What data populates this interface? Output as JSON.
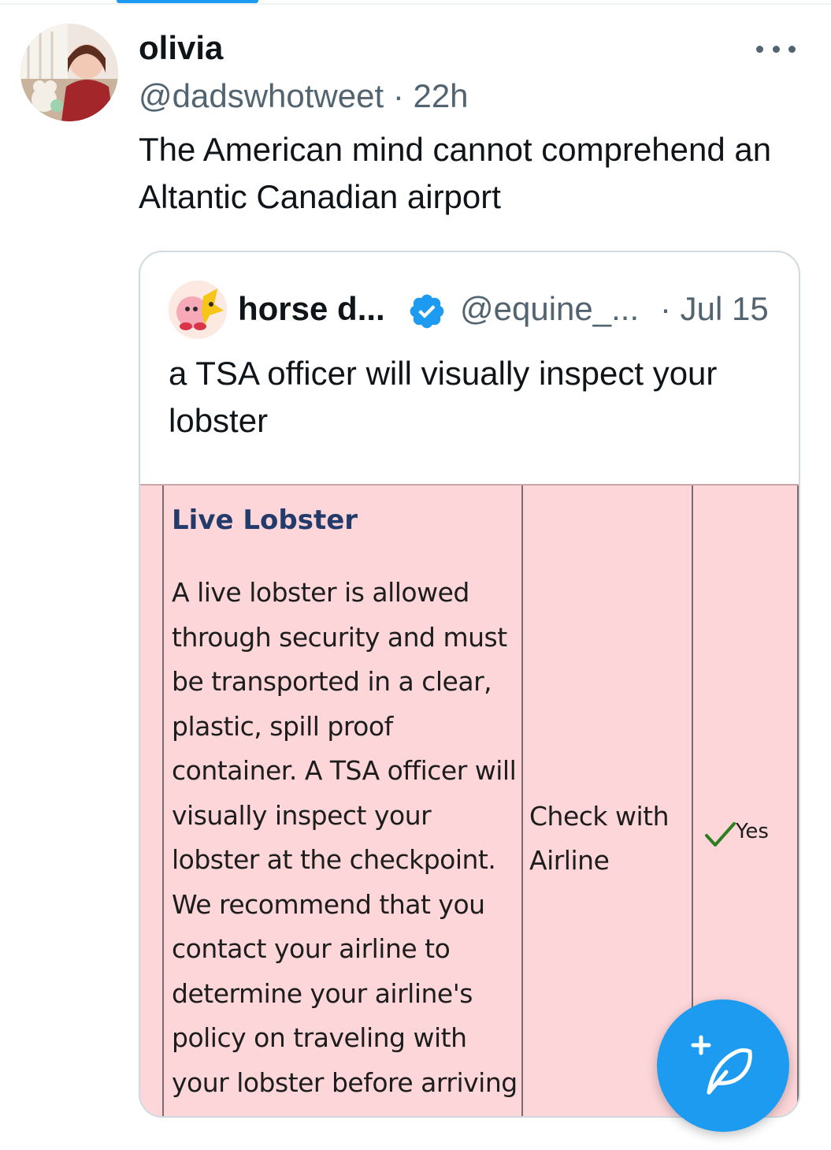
{
  "tweet": {
    "author_name": "olivia",
    "handle_time": "@dadswhotweet · 22h",
    "text": "The American mind cannot comprehend an Altantic Canadian airport"
  },
  "quoted_tweet": {
    "author_name": "horse d...",
    "handle": "@equine_...",
    "date": "· Jul 15",
    "text": "a TSA officer will visually inspect your lobster"
  },
  "tsa_table": {
    "item_title": "Live Lobster",
    "description": "A live lobster is allowed through security and must be transported in a clear, plastic, spill proof container. A TSA officer will visually inspect your lobster at the checkpoint. We recommend that you contact your airline to determine your airline's policy on traveling with your lobster before arriving at the airport.",
    "carry_on": "Check with Airline",
    "checked": "Yes"
  },
  "icons": {
    "more": "more-icon",
    "verified": "verified-badge-icon",
    "check": "checkmark-icon",
    "compose": "compose-post-icon"
  },
  "colors": {
    "accent": "#1d9bf0",
    "table_bg": "#fdd6d9",
    "title_blue": "#233b6b",
    "check_green": "#2e7d1e"
  }
}
